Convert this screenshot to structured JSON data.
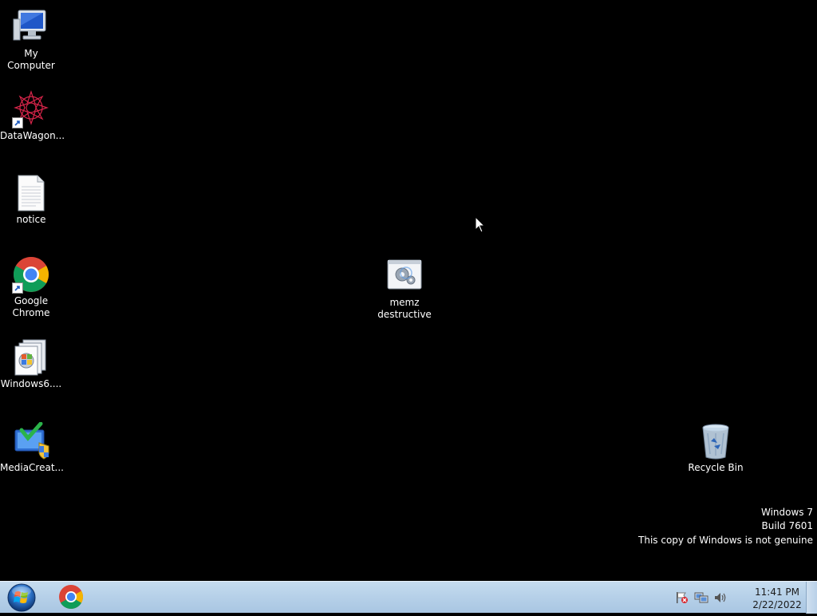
{
  "desktop": {
    "icons": [
      {
        "name": "My Computer",
        "icon": "computer-icon"
      },
      {
        "name": "DataWagon...",
        "icon": "datawagon-icon",
        "shortcut": true
      },
      {
        "name": "notice",
        "icon": "text-file-icon"
      },
      {
        "name": "Google Chrome",
        "icon": "chrome-icon",
        "shortcut": true
      },
      {
        "name": "Windows6....",
        "icon": "windows-update-package-icon"
      },
      {
        "name": "MediaCreat...",
        "icon": "media-creation-tool-icon"
      },
      {
        "name": "memz destructive",
        "icon": "executable-icon"
      },
      {
        "name": "Recycle Bin",
        "icon": "recycle-bin-icon"
      }
    ]
  },
  "watermark": {
    "line1": "Windows 7",
    "line2": "Build 7601",
    "line3": "This copy of Windows is not genuine"
  },
  "taskbar": {
    "start": "start-orb-icon",
    "pinned": [
      {
        "name": "Google Chrome",
        "icon": "chrome-icon"
      }
    ],
    "tray": {
      "icons": [
        "action-center-flag-icon",
        "network-icon",
        "volume-icon"
      ],
      "time": "11:41 PM",
      "date": "2/22/2022"
    }
  },
  "colors": {
    "desktop_bg": "#000000",
    "taskbar_top": "#c6dcef",
    "taskbar_bottom": "#a9c6e2"
  }
}
